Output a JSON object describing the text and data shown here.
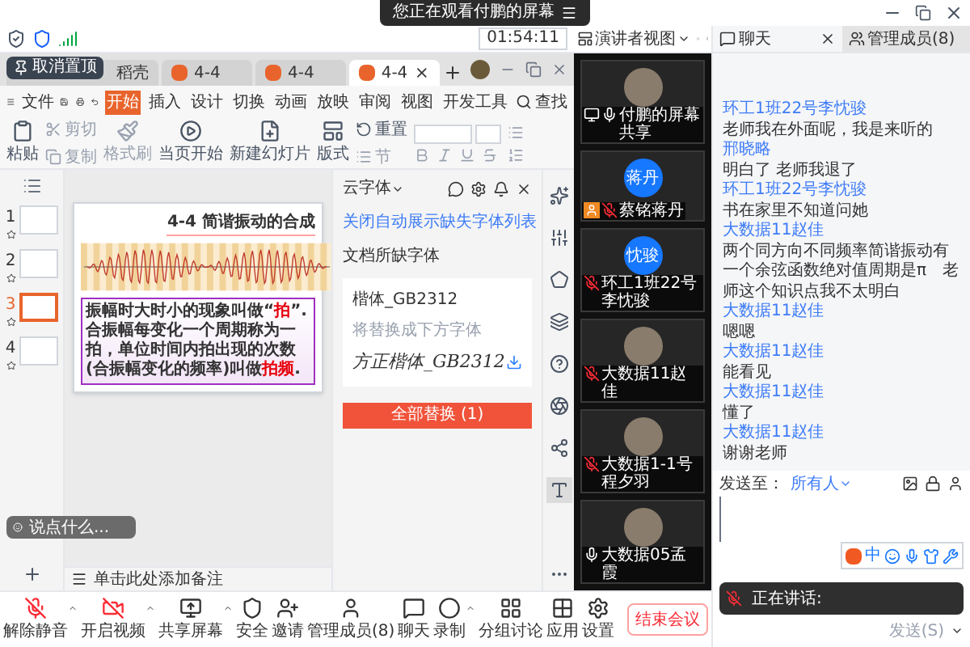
{
  "screen_share_banner": {
    "text": "您正在观看付鹏的屏幕"
  },
  "status_bar": {
    "time": "01:54:11"
  },
  "wps": {
    "tooltip": "取消置顶",
    "tabs": [
      {
        "label": "稻壳",
        "kind": "home",
        "selected": false
      },
      {
        "label": "4-4",
        "kind": "doc",
        "selected": false
      },
      {
        "label": "4-4",
        "kind": "doc",
        "selected": false
      },
      {
        "label": "4-4",
        "kind": "doc",
        "selected": true
      }
    ],
    "menu": {
      "file": "文件",
      "tabs": [
        {
          "label": "开始",
          "selected": true
        },
        {
          "label": "插入",
          "selected": false
        },
        {
          "label": "设计",
          "selected": false
        },
        {
          "label": "切换",
          "selected": false
        },
        {
          "label": "动画",
          "selected": false
        },
        {
          "label": "放映",
          "selected": false
        },
        {
          "label": "审阅",
          "selected": false
        },
        {
          "label": "视图",
          "selected": false
        },
        {
          "label": "开发工具",
          "selected": false
        }
      ],
      "search": "查找"
    },
    "ribbon": {
      "paste": "粘贴",
      "cut": "剪切",
      "copy": "复制",
      "format_painter": "格式刷",
      "play": "当页开始",
      "new_slide": "新建幻灯片",
      "layout": "版式",
      "reset": "重置",
      "section": "节"
    },
    "slides": [
      {
        "number": "1",
        "selected": false
      },
      {
        "number": "2",
        "selected": false
      },
      {
        "number": "3",
        "selected": true
      },
      {
        "number": "4",
        "selected": false
      }
    ],
    "slide": {
      "title": "4-4 简谐振动的合成",
      "body": [
        {
          "text": "振幅时大时小的现象叫做“",
          "emphasis": false
        },
        {
          "text": "拍",
          "emphasis": true
        },
        {
          "text": "”.合振幅每变化一个周期称为一拍，单位时间内拍出现的次数(合振幅变化的频率)叫做",
          "emphasis": false
        },
        {
          "text": "拍频",
          "emphasis": true
        },
        {
          "text": ".",
          "emphasis": false
        }
      ]
    },
    "notes_hint": "单击此处添加备注",
    "comment": {
      "placeholder": "说点什么..."
    },
    "font_panel": {
      "title": "云字体",
      "toggle_link": "关闭自动展示缺失字体列表",
      "section": "文档所缺字体",
      "missing_font": "楷体_GB2312",
      "replace_hint": "将替换成下方字体",
      "replacement_font": "方正楷体_GB2312",
      "button": "全部替换 (1)"
    },
    "side_tools": [
      {
        "selected": false
      },
      {
        "selected": false
      },
      {
        "selected": false
      },
      {
        "selected": false
      },
      {
        "selected": false
      },
      {
        "selected": false
      },
      {
        "selected": false
      },
      {
        "selected": true
      }
    ]
  },
  "meeting": {
    "view_button": "演讲者视图",
    "participants": [
      {
        "name": "付鹏的屏幕共享",
        "sharing": true,
        "host": false,
        "muted": false
      },
      {
        "name": "蔡铭蒋丹",
        "initials": "蒋丹",
        "sharing": false,
        "host": true,
        "muted": true
      },
      {
        "name": "环工1班22号李忱骏",
        "initials": "忱骏",
        "sharing": false,
        "host": false,
        "muted": true
      },
      {
        "name": "大数据11赵佳",
        "sharing": false,
        "host": false,
        "muted": true
      },
      {
        "name": "大数据1-1号程夕羽",
        "sharing": false,
        "host": false,
        "muted": true
      },
      {
        "name": "大数据05孟霞",
        "sharing": false,
        "host": false,
        "muted": false
      }
    ],
    "toolbar": [
      {
        "label": "解除静音",
        "off": true,
        "menu": true
      },
      {
        "label": "开启视频",
        "off": true,
        "menu": true
      },
      {
        "label": "共享屏幕",
        "off": false,
        "menu": true
      },
      {
        "label": "安全",
        "off": false,
        "menu": false
      },
      {
        "label": "邀请",
        "off": false,
        "menu": false
      },
      {
        "label": "管理成员(8)",
        "off": false,
        "menu": false
      },
      {
        "label": "聊天",
        "off": false,
        "menu": false
      },
      {
        "label": "录制",
        "off": false,
        "menu": true
      },
      {
        "label": "分组讨论",
        "off": false,
        "menu": false
      },
      {
        "label": "应用",
        "off": false,
        "menu": false
      },
      {
        "label": "设置",
        "off": false,
        "menu": false
      }
    ],
    "end_button": "结束会议"
  },
  "chat": {
    "tabs": [
      {
        "label": "聊天",
        "selected": true
      },
      {
        "label": "管理成员(8)",
        "selected": false
      }
    ],
    "messages": [
      {
        "sender": "环工1班22号李忱骏",
        "text": "老师我在外面呢，我是来听的"
      },
      {
        "sender": "邢晓略",
        "text": "明白了 老师我退了"
      },
      {
        "sender": "环工1班22号李忱骏",
        "text": "书在家里不知道问她"
      },
      {
        "sender": "大数据11赵佳",
        "text": "两个同方向不同频率简谐振动有一个余弦函数绝对值周期是π　老师这个知识点我不太明白"
      },
      {
        "sender": "大数据11赵佳",
        "text": "嗯嗯"
      },
      {
        "sender": "大数据11赵佳",
        "text": "能看见"
      },
      {
        "sender": "大数据11赵佳",
        "text": "懂了"
      },
      {
        "sender": "大数据11赵佳",
        "text": "谢谢老师"
      }
    ],
    "send_to_label": "发送至：",
    "send_to": "所有人",
    "ime_mode": "中",
    "speaking_label": "正在讲话:",
    "send_button": "发送(S)"
  }
}
